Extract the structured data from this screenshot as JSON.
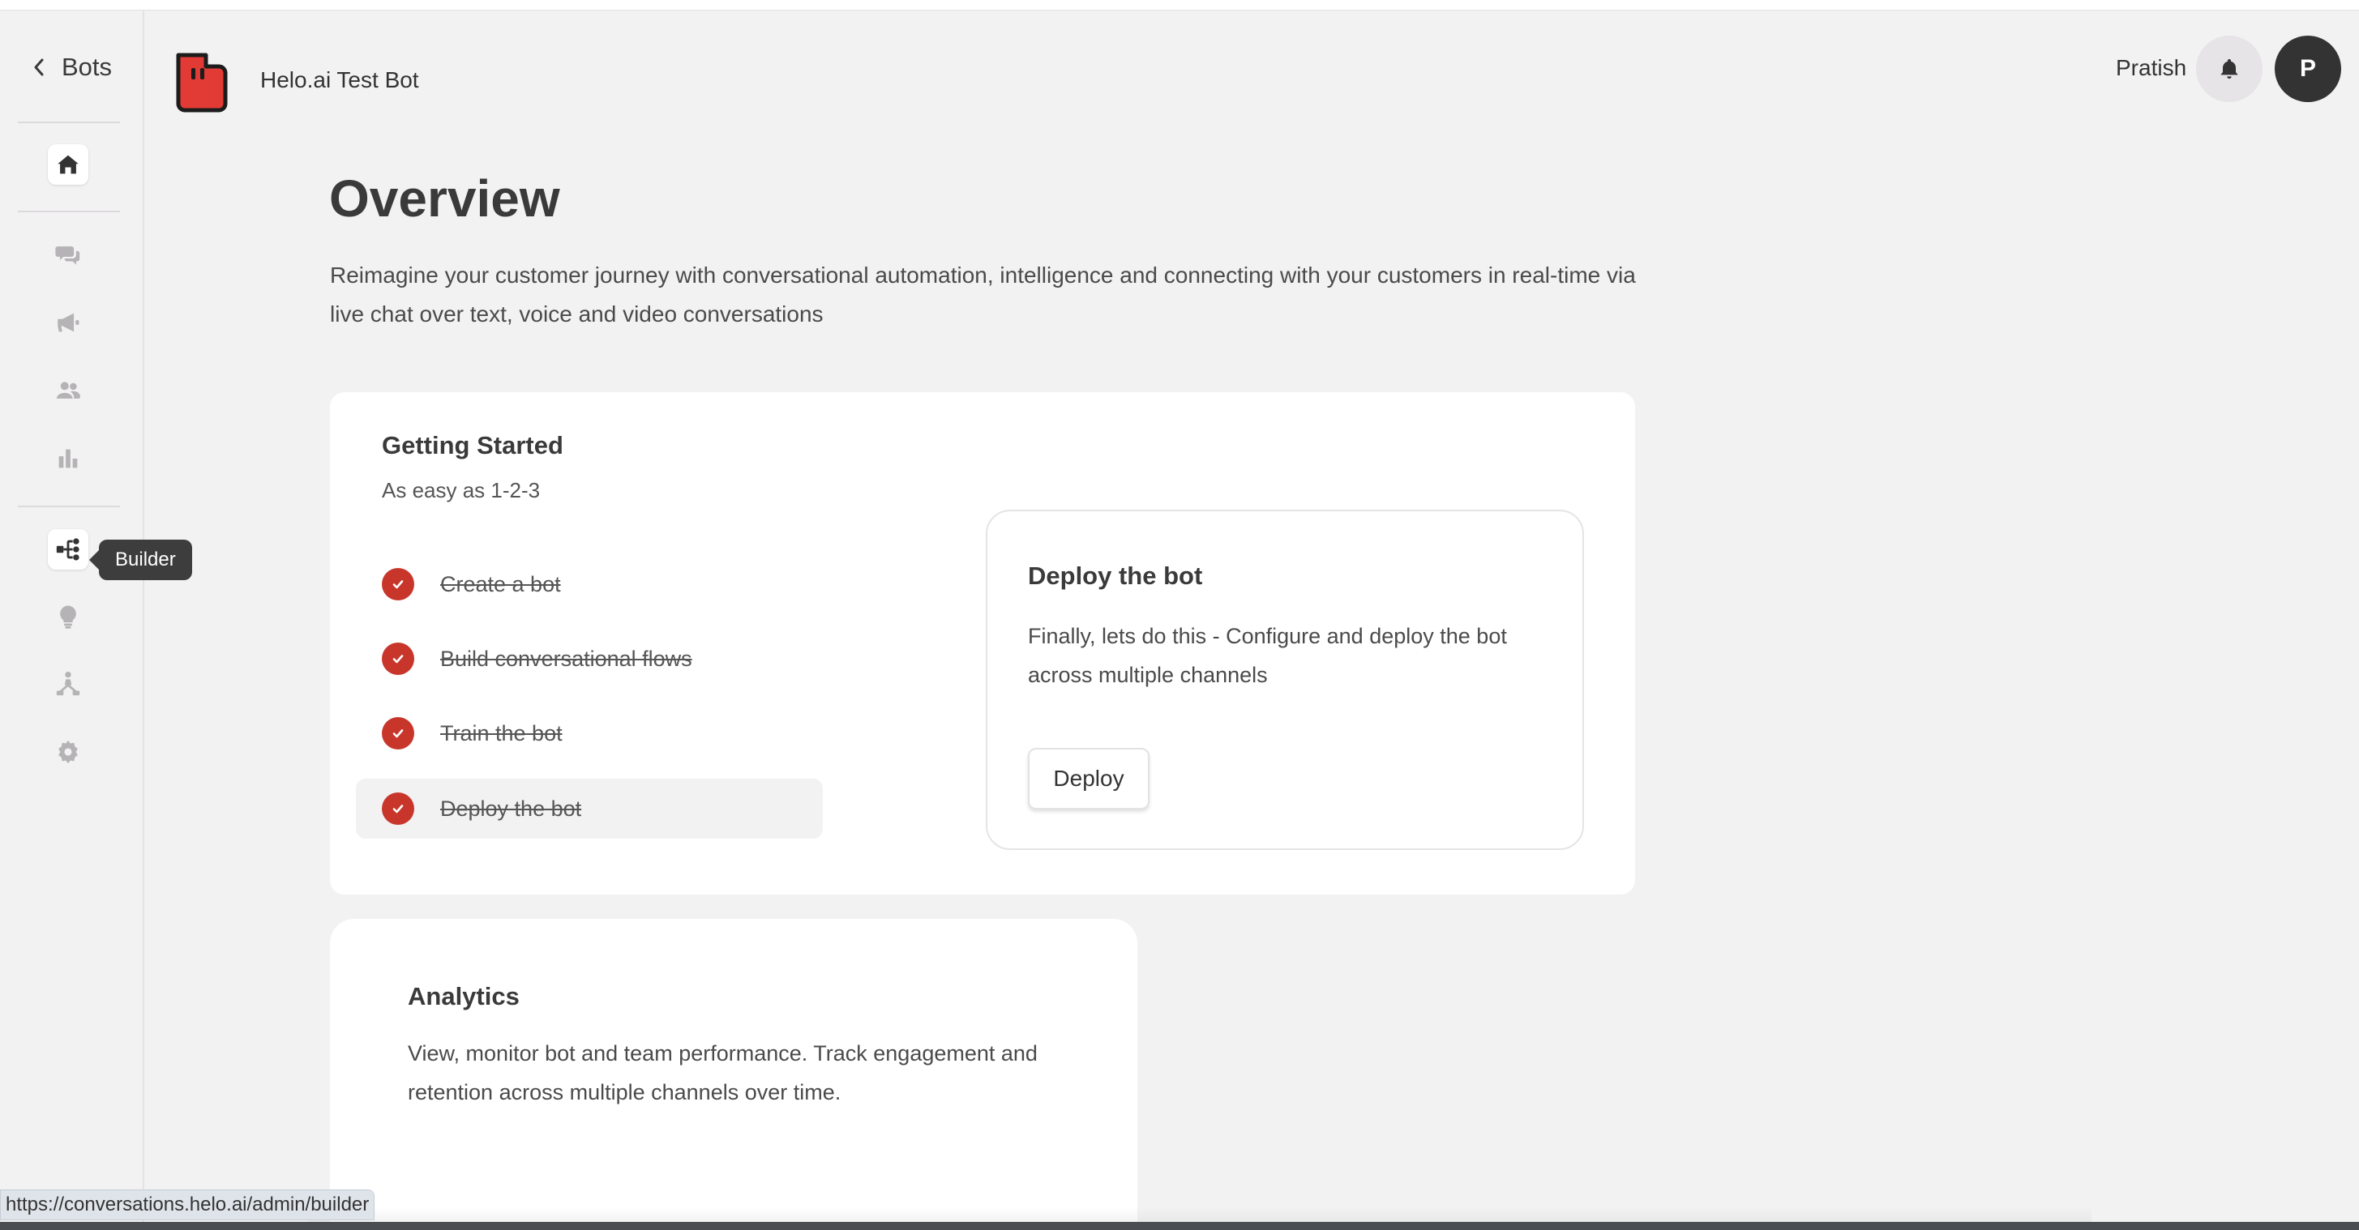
{
  "sidebar": {
    "back_label": "Bots",
    "tooltip": "Builder",
    "icons": [
      "home-icon",
      "chat-icon",
      "megaphone-icon",
      "users-icon",
      "bar-chart-icon",
      "builder-flow-icon",
      "lightbulb-icon",
      "hierarchy-icon",
      "settings-icon"
    ]
  },
  "header": {
    "bot_name": "Helo.ai Test Bot",
    "user_name": "Pratish",
    "avatar_initial": "P"
  },
  "main": {
    "title": "Overview",
    "description": "Reimagine your customer journey with conversational automation, intelligence and connecting with your customers in real-time via live chat over text, voice and video conversations"
  },
  "getting_started": {
    "title": "Getting Started",
    "subtitle": "As easy as 1-2-3",
    "steps": [
      {
        "label": "Create a bot"
      },
      {
        "label": "Build conversational flows"
      },
      {
        "label": "Train the bot"
      },
      {
        "label": "Deploy the bot"
      }
    ]
  },
  "deploy_panel": {
    "title": "Deploy the bot",
    "description": "Finally, lets do this - Configure and deploy the bot across multiple channels",
    "button_label": "Deploy"
  },
  "analytics": {
    "title": "Analytics",
    "description": "View, monitor bot and team performance. Track engagement and retention across multiple channels over time."
  },
  "status_url": "https://conversations.helo.ai/admin/builder",
  "colors": {
    "accent": "#c8362b",
    "logo_red": "#e23a35",
    "background": "#f3f2f3"
  }
}
